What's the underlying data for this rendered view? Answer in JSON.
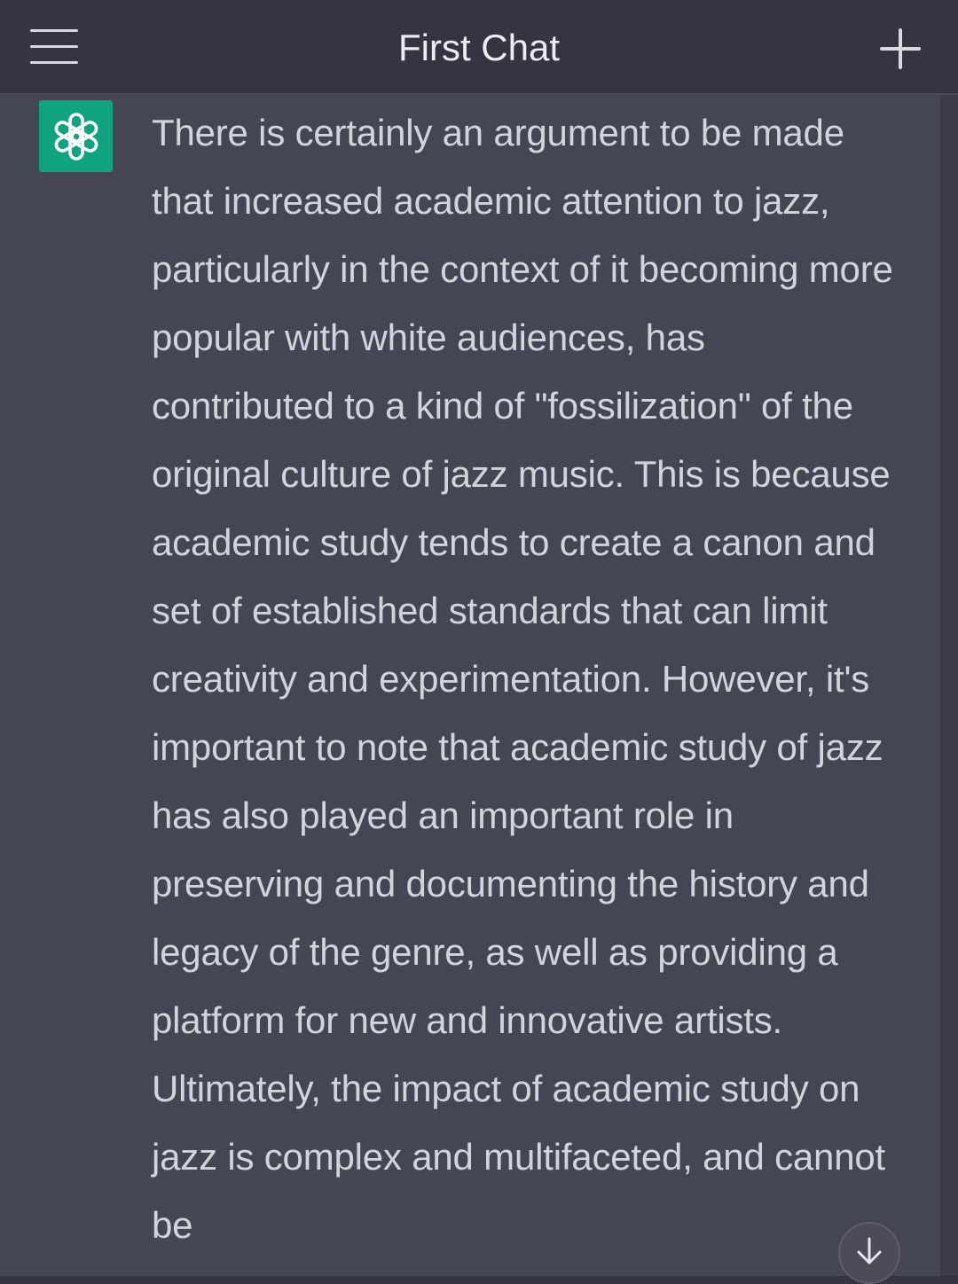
{
  "header": {
    "title": "First Chat",
    "menu_icon": "hamburger-menu-icon",
    "new_chat_icon": "plus-icon"
  },
  "conversation": {
    "assistant_avatar_icon": "openai-logo-icon",
    "message_text": "There is certainly an argument to be made that increased academic attention to jazz, particularly in the context of it becoming more popular with white audiences, has contributed to a kind of \"fossilization\" of the original culture of jazz music. This is because academic study tends to create a canon and set of established standards that can limit creativity and experimentation. However, it's important to note that academic study of jazz has also played an important role in preserving and documenting the history and legacy of the genre, as well as providing a platform for new and innovative artists. Ultimately, the impact of academic study on jazz is complex and multifaceted, and cannot be",
    "scroll_down_icon": "arrow-down-icon"
  },
  "colors": {
    "background": "#343541",
    "message_background": "#444654",
    "avatar_background": "#10a37f",
    "text": "#d1d5db",
    "title_text": "#ececf1"
  }
}
